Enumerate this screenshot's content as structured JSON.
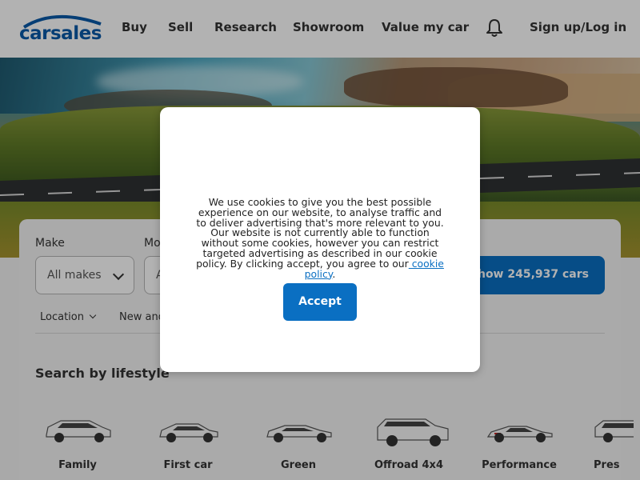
{
  "header": {
    "logo_text": "carsales",
    "nav": [
      {
        "label": "Buy"
      },
      {
        "label": "Sell"
      },
      {
        "label": "Research"
      },
      {
        "label": "Showroom"
      },
      {
        "label": "Value my car"
      }
    ],
    "signin_label": "Sign up/Log in",
    "bell_icon": "bell-icon"
  },
  "search": {
    "make_label": "Make",
    "make_value": "All makes",
    "model_label": "Mo",
    "model_value": "A",
    "show_button": "Show 245,937 cars",
    "filters": [
      {
        "label": "Location"
      },
      {
        "label": "New and"
      }
    ],
    "lifestyle_title": "Search by lifestyle",
    "lifestyle": [
      {
        "label": "Family"
      },
      {
        "label": "First car"
      },
      {
        "label": "Green"
      },
      {
        "label": "Offroad 4x4"
      },
      {
        "label": "Performance"
      },
      {
        "label": "Pres"
      }
    ]
  },
  "cookie": {
    "text": "We use cookies to give you the best possible experience on our website, to analyse traffic and to deliver advertising that's more relevant to you. Our website is not currently able to function without some cookies, however you can restrict targeted advertising as described in our cookie policy. By clicking accept, you agree to our",
    "link": " cookie policy",
    "trail": ".",
    "accept": "Accept"
  },
  "colors": {
    "brand": "#0a5aa8",
    "primary_button": "#0a6fc2"
  }
}
